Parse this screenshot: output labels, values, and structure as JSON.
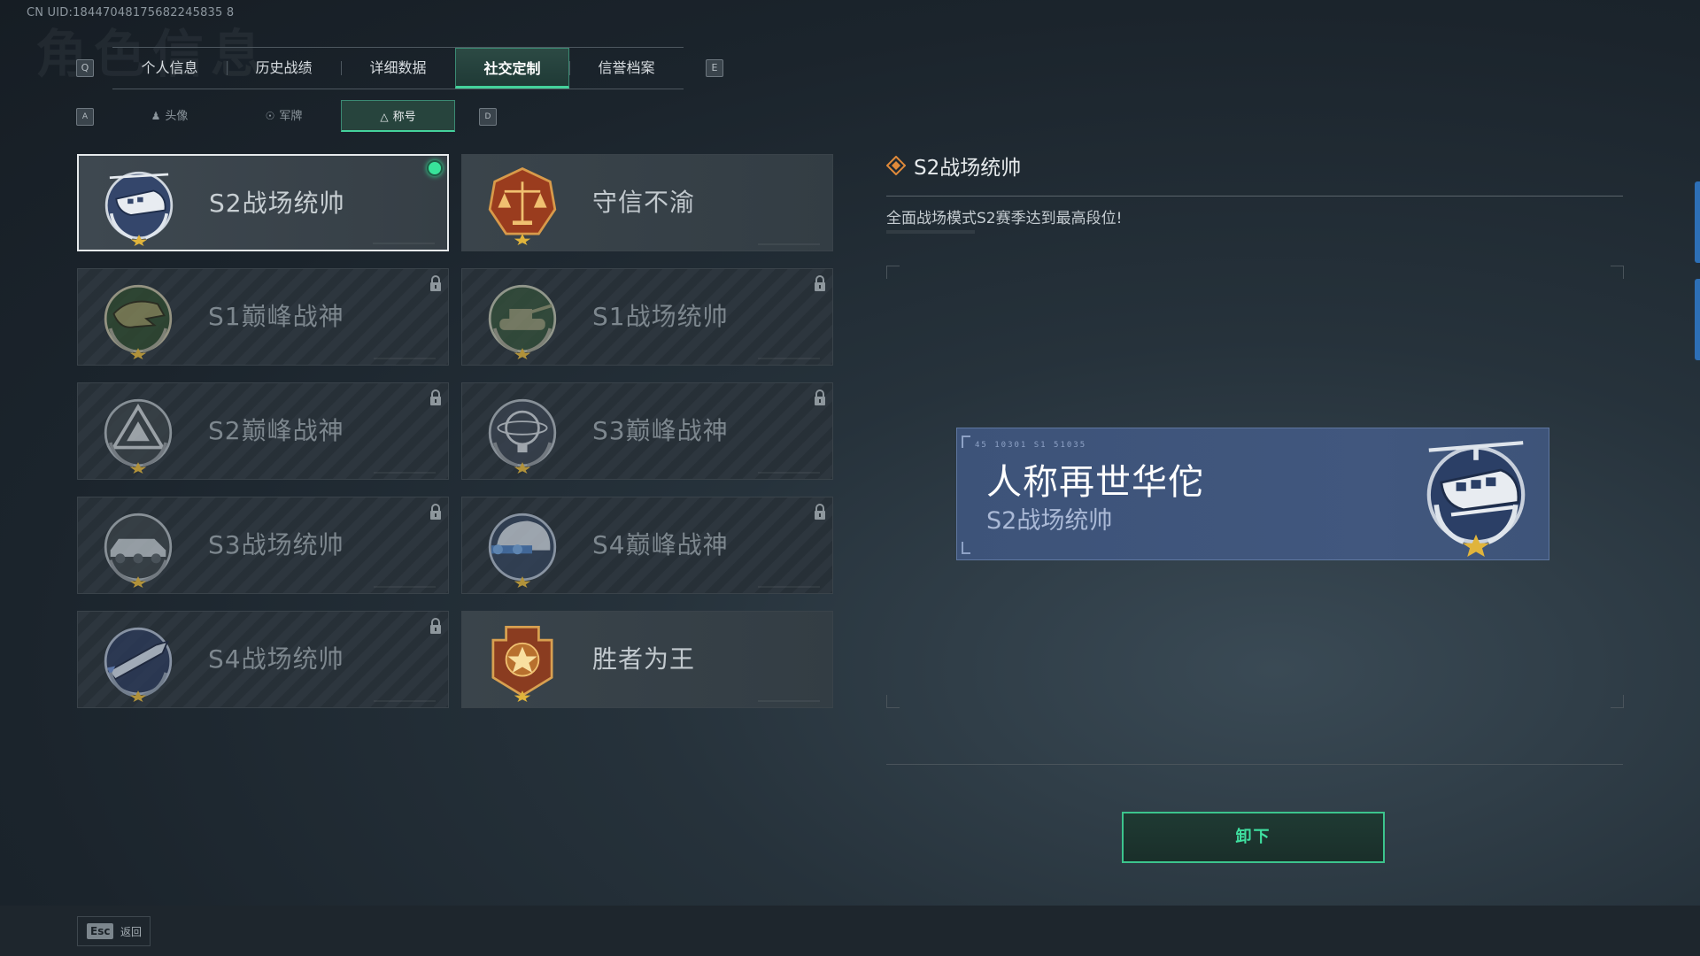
{
  "uid": "CN UID:18447048175682245835 8",
  "background_title": "角色信息",
  "hotkeys": {
    "prev_tab": "Q",
    "next_tab": "E",
    "prev_sub": "A",
    "next_sub": "D"
  },
  "top_tabs": [
    {
      "label": "个人信息"
    },
    {
      "label": "历史战绩"
    },
    {
      "label": "详细数据"
    },
    {
      "label": "社交定制",
      "active": true
    },
    {
      "label": "信誉档案"
    }
  ],
  "sub_tabs": [
    {
      "label": "头像",
      "icon": "person-icon"
    },
    {
      "label": "军牌",
      "icon": "dogtag-icon"
    },
    {
      "label": "称号",
      "icon": "title-icon",
      "active": true
    }
  ],
  "titles": [
    {
      "name": "S2战场统帅",
      "medal": "helicopter",
      "state": "equipped"
    },
    {
      "name": "守信不渝",
      "medal": "scales",
      "state": "unlocked"
    },
    {
      "name": "S1巅峰战神",
      "medal": "crocodile",
      "state": "locked"
    },
    {
      "name": "S1战场统帅",
      "medal": "tank",
      "state": "locked"
    },
    {
      "name": "S2巅峰战神",
      "medal": "pyramid",
      "state": "locked"
    },
    {
      "name": "S3巅峰战神",
      "medal": "globe",
      "state": "locked"
    },
    {
      "name": "S3战场统帅",
      "medal": "armored-car",
      "state": "locked"
    },
    {
      "name": "S4巅峰战神",
      "medal": "helmet",
      "state": "locked"
    },
    {
      "name": "S4战场统帅",
      "medal": "missile",
      "state": "locked"
    },
    {
      "name": "胜者为王",
      "medal": "star-badge",
      "state": "unlocked"
    }
  ],
  "detail": {
    "title": "S2战场统帅",
    "description": "全面战场模式S2赛季达到最高段位!"
  },
  "preview": {
    "code": "45 10301  S1 51035",
    "main": "人称再世华佗",
    "sub": "S2战场统帅"
  },
  "action_button": "卸下",
  "footer": {
    "esc_key": "Esc",
    "esc_label": "返回"
  },
  "colors": {
    "accent": "#44d29c",
    "banner": "#41577e",
    "equipped": "#38e39a"
  }
}
